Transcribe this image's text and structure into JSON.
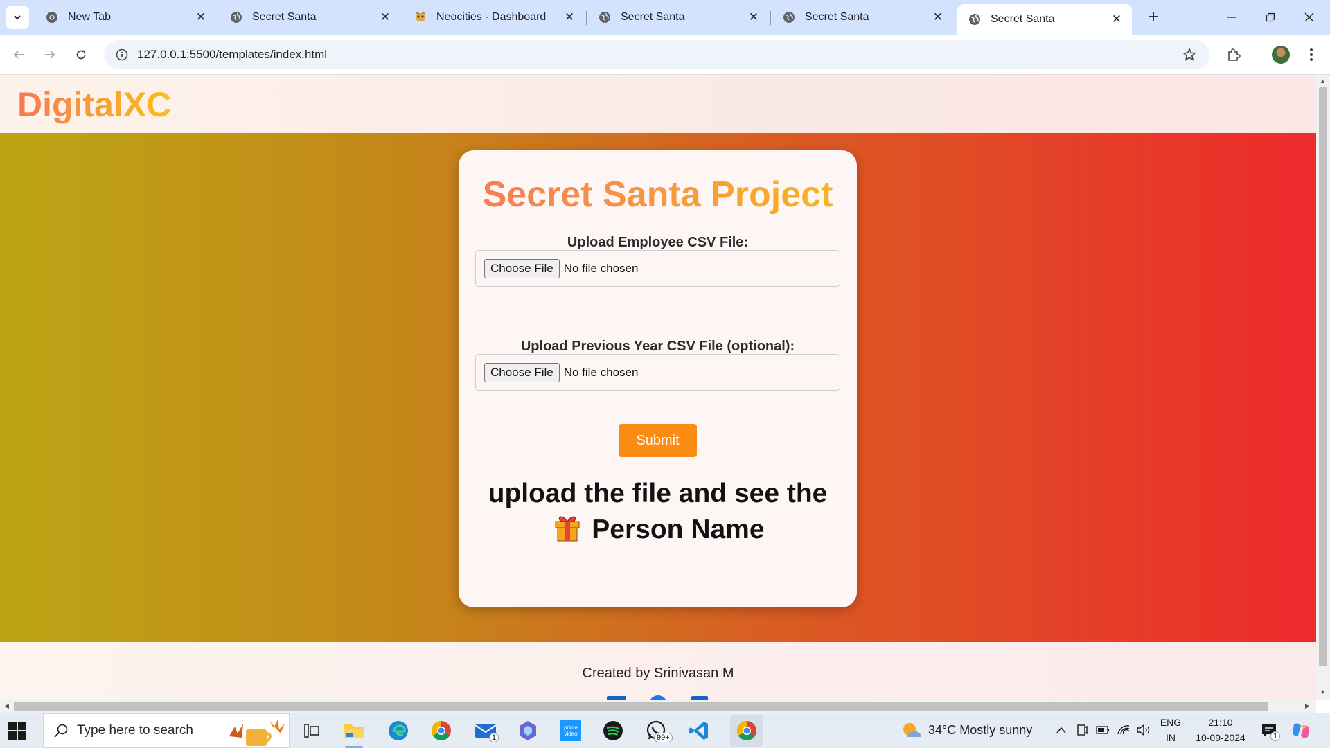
{
  "browser": {
    "tabs": [
      {
        "title": "New Tab",
        "favicon": "chrome-icon",
        "active": false
      },
      {
        "title": "Secret Santa",
        "favicon": "globe-icon",
        "active": false
      },
      {
        "title": "Neocities - Dashboard",
        "favicon": "neocities-icon",
        "active": false
      },
      {
        "title": "Secret Santa",
        "favicon": "globe-icon",
        "active": false
      },
      {
        "title": "Secret Santa",
        "favicon": "globe-icon",
        "active": false
      },
      {
        "title": "Secret Santa",
        "favicon": "globe-icon",
        "active": true
      }
    ],
    "new_tab": "+",
    "url": "127.0.0.1:5500/templates/index.html"
  },
  "page": {
    "logo": "DigitalXC",
    "card": {
      "title": "Secret Santa Project",
      "employee_label": "Upload Employee CSV File:",
      "previous_label": "Upload Previous Year CSV File (optional):",
      "choose_file": "Choose File",
      "no_file": "No file chosen",
      "submit": "Submit",
      "message_part1": "upload the file and see the",
      "message_part2": "Person Name"
    },
    "footer": {
      "credit": "Created by Srinivasan M"
    }
  },
  "taskbar": {
    "search_placeholder": "Type here to search",
    "mail_badge": "1",
    "whatsapp_badge": "99+",
    "weather": "34°C  Mostly sunny",
    "lang_top": "ENG",
    "lang_bottom": "IN",
    "time": "21:10",
    "date": "10-09-2024",
    "notification_badge": "1"
  },
  "colors": {
    "tab_strip": "#d3e3fd",
    "hero_start": "#bca514",
    "hero_end": "#ed2a2c",
    "submit": "#fb8b12"
  }
}
